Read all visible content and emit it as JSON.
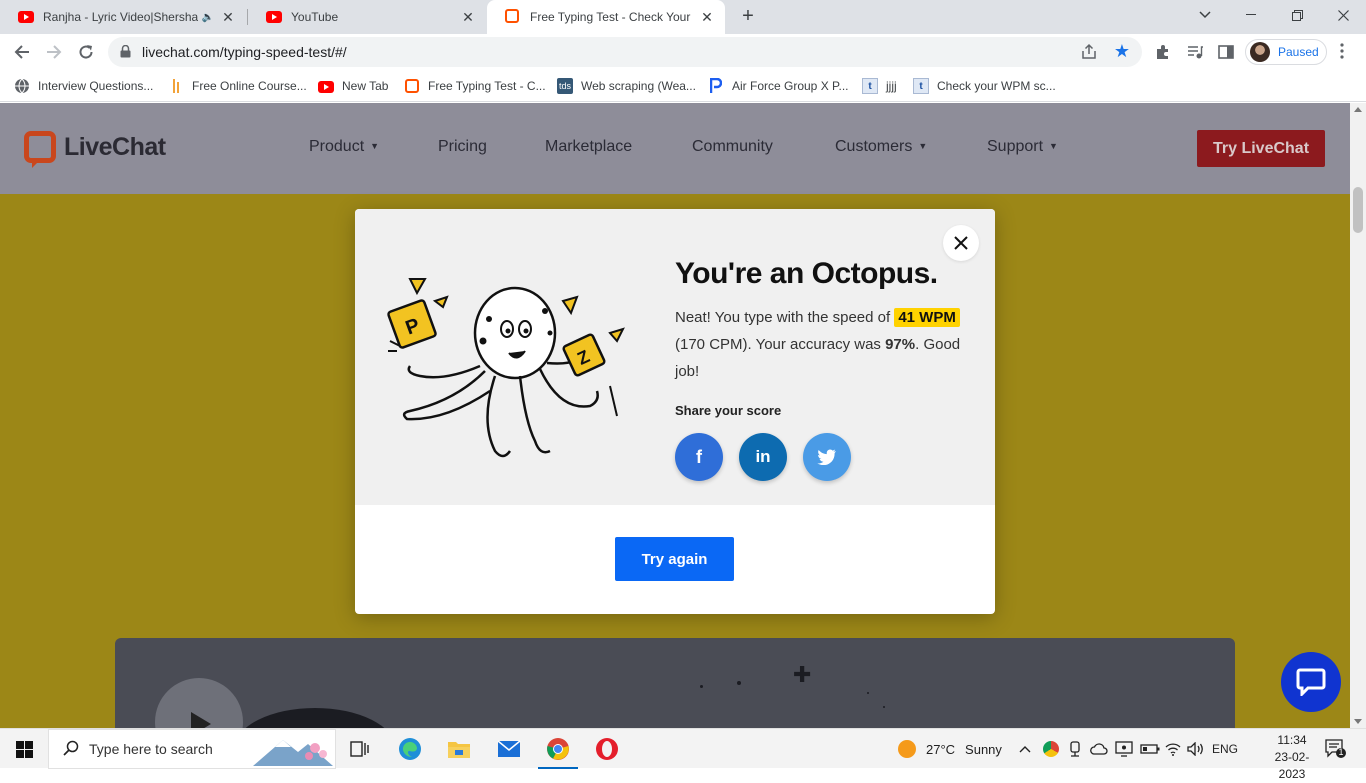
{
  "browser": {
    "tabs": [
      {
        "title": "Ranjha - Lyric Video|Shershaah",
        "icon": "youtube-icon",
        "audio": "speaker-icon"
      },
      {
        "title": "YouTube",
        "icon": "youtube-icon"
      },
      {
        "title": "Free Typing Test - Check Your Typing Speed",
        "icon": "livechat-icon",
        "active": true
      }
    ],
    "url": "livechat.com/typing-speed-test/#/",
    "profile_label": "Paused",
    "bookmarks": [
      {
        "label": "Interview Questions...",
        "icon": "globe-icon"
      },
      {
        "label": "Free Online Course...",
        "icon": "bar-icon"
      },
      {
        "label": "New Tab",
        "icon": "youtube-icon"
      },
      {
        "label": "Free Typing Test - C...",
        "icon": "livechat-icon"
      },
      {
        "label": "Web scraping (Wea...",
        "icon": "tds-icon"
      },
      {
        "label": "Air Force Group X P...",
        "icon": "p-icon"
      },
      {
        "label": "jjjj",
        "icon": "t-icon"
      },
      {
        "label": "Check your WPM sc...",
        "icon": "t-icon"
      }
    ],
    "bookmark_tds": "tds",
    "bookmark_t": "t"
  },
  "site": {
    "logo_text": "LiveChat",
    "nav": [
      {
        "label": "Product",
        "dropdown": true
      },
      {
        "label": "Pricing",
        "dropdown": false
      },
      {
        "label": "Marketplace",
        "dropdown": false
      },
      {
        "label": "Community",
        "dropdown": false
      },
      {
        "label": "Customers",
        "dropdown": true
      },
      {
        "label": "Support",
        "dropdown": true
      }
    ],
    "cta_label": "Try LiveChat",
    "colors": {
      "background": "#9c8717",
      "header": "#8e8d99",
      "cta": "#8c1a1e",
      "accent_blue": "#0a68f5",
      "highlight": "#ffd200"
    }
  },
  "modal": {
    "title": "You're an Octopus.",
    "text_1": "Neat! You type with the speed of",
    "wpm": "41 WPM",
    "cpm_text": "(170 CPM). Your accuracy was",
    "accuracy": "97%",
    "text_end": ". Good job!",
    "share_label": "Share your score",
    "social": [
      {
        "name": "facebook",
        "glyph": "f",
        "color": "#2f6ed8"
      },
      {
        "name": "linkedin",
        "glyph": "in",
        "color": "#0d6bb0"
      },
      {
        "name": "twitter",
        "glyph": "twitter-bird",
        "color": "#4a9be6"
      }
    ],
    "try_again_label": "Try again",
    "illustration_letters": [
      "P",
      "Z"
    ]
  },
  "taskbar": {
    "search_placeholder": "Type here to search",
    "weather_temp": "27°C",
    "weather_desc": "Sunny",
    "language": "ENG",
    "time": "11:34",
    "date": "23-02-2023",
    "notification_count": "1"
  }
}
